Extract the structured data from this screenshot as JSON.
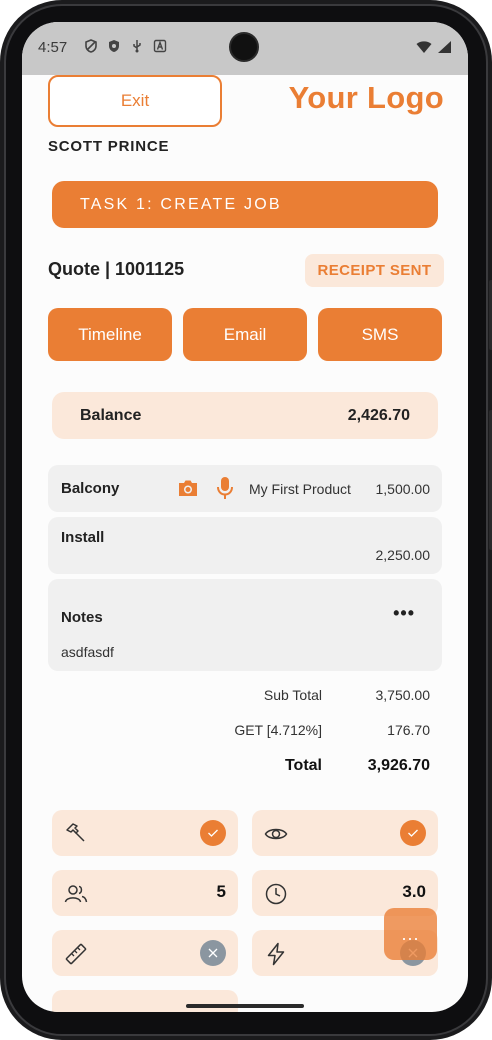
{
  "status_bar": {
    "time": "4:57"
  },
  "header": {
    "exit_label": "Exit",
    "logo_text": "Your Logo",
    "customer_name": "SCOTT PRINCE"
  },
  "task": {
    "label": "TASK 1: CREATE JOB"
  },
  "quote": {
    "title": "Quote | 1001125",
    "status_badge": "RECEIPT SENT"
  },
  "actions": [
    {
      "label": "Timeline"
    },
    {
      "label": "Email"
    },
    {
      "label": "SMS"
    }
  ],
  "balance": {
    "label": "Balance",
    "value": "2,426.70"
  },
  "line_items": [
    {
      "name": "Balcony",
      "product": "My First Product",
      "price": "1,500.00"
    },
    {
      "name": "Install",
      "price": "2,250.00"
    }
  ],
  "notes": {
    "label": "Notes",
    "menu": "•••",
    "text": "asdfasdf"
  },
  "totals": [
    {
      "label": "Sub Total",
      "value": "3,750.00"
    },
    {
      "label": "GET [4.712%]",
      "value": "176.70"
    },
    {
      "label": "Total",
      "value": "3,926.70"
    }
  ],
  "tiles": [
    {
      "icon": "hammer-icon",
      "state": "checked"
    },
    {
      "icon": "eye-icon",
      "state": "checked"
    },
    {
      "icon": "people-icon",
      "value": "5"
    },
    {
      "icon": "clock-icon",
      "value": "3.0"
    },
    {
      "icon": "ruler-icon",
      "state": "off"
    },
    {
      "icon": "lightning-icon",
      "state": "off"
    }
  ],
  "fab": {
    "label": "..."
  },
  "colors": {
    "accent": "#ea7e34",
    "accent_light": "#fbe8da",
    "muted": "#8b96a0"
  }
}
